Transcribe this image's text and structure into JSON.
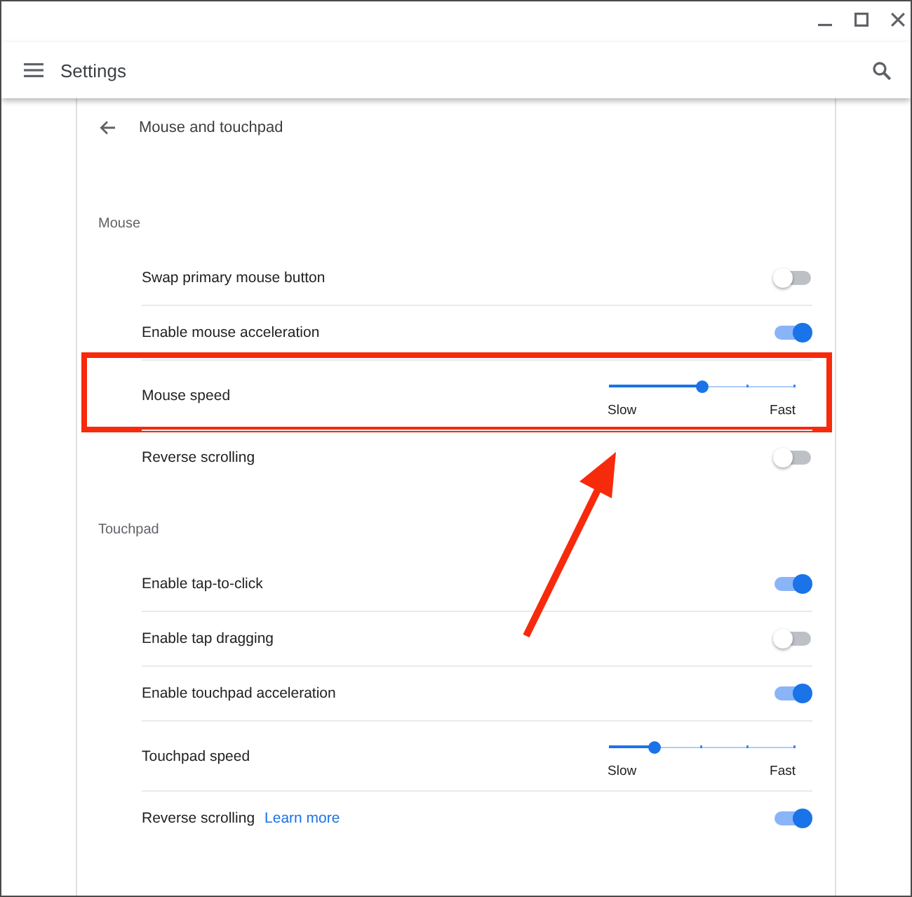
{
  "header": {
    "title": "Settings"
  },
  "page": {
    "title": "Mouse and touchpad"
  },
  "sections": [
    {
      "heading": "Mouse",
      "items": [
        {
          "kind": "toggle",
          "label": "Swap primary mouse button",
          "on": false,
          "highlighted": false
        },
        {
          "kind": "toggle",
          "label": "Enable mouse acceleration",
          "on": true,
          "highlighted": false
        },
        {
          "kind": "slider",
          "label": "Mouse speed",
          "level": 0.5,
          "min_label": "Slow",
          "max_label": "Fast",
          "highlighted": true
        },
        {
          "kind": "toggle",
          "label": "Reverse scrolling",
          "on": false,
          "highlighted": false
        }
      ]
    },
    {
      "heading": "Touchpad",
      "items": [
        {
          "kind": "toggle",
          "label": "Enable tap-to-click",
          "on": true,
          "highlighted": false
        },
        {
          "kind": "toggle",
          "label": "Enable tap dragging",
          "on": false,
          "highlighted": false
        },
        {
          "kind": "toggle",
          "label": "Enable touchpad acceleration",
          "on": true,
          "highlighted": false
        },
        {
          "kind": "slider",
          "label": "Touchpad speed",
          "level": 0.25,
          "min_label": "Slow",
          "max_label": "Fast",
          "highlighted": false
        },
        {
          "kind": "toggle",
          "label": "Reverse scrolling",
          "link": "Learn more",
          "on": true,
          "highlighted": false
        }
      ]
    }
  ]
}
